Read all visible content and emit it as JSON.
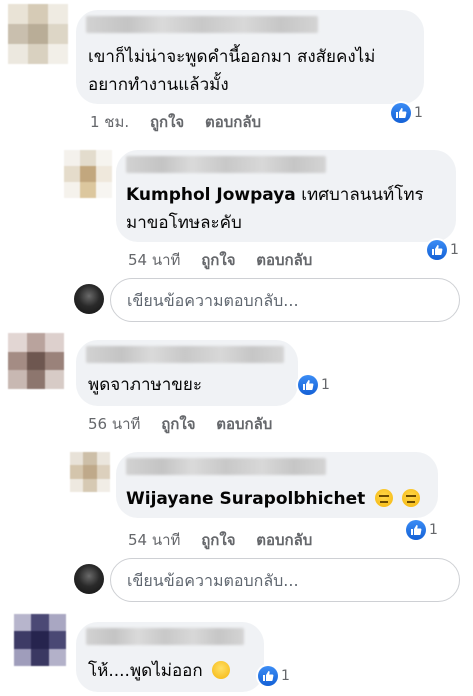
{
  "colors": {
    "bubble": "#f0f2f5",
    "like_blue": "#1877f2",
    "meta_gray": "#65676b",
    "text": "#050505"
  },
  "comments": [
    {
      "text_lines": [
        "เขาก็ไม่น่าจะพูดคำนี้ออกมา สงสัยคงไม่",
        "อยากทำงานแล้วมั้ง"
      ],
      "time": "1 ชม.",
      "like_label": "ถูกใจ",
      "reply_label": "ตอบกลับ",
      "reaction_count": "1",
      "reaction_icon": "like-icon"
    },
    {
      "mention": "Kumphol Jowpaya",
      "text_after_mention": "เทศบาลนนท์โทร",
      "text_line2": "มาขอโทษละคับ",
      "time": "54 นาที",
      "like_label": "ถูกใจ",
      "reply_label": "ตอบกลับ",
      "reaction_count": "1",
      "reaction_icon": "like-icon"
    },
    {
      "text": "พูดจาภาษาขยะ",
      "time": "56 นาที",
      "like_label": "ถูกใจ",
      "reply_label": "ตอบกลับ",
      "reaction_count": "1",
      "reaction_icon": "like-icon"
    },
    {
      "mention": "Wijayane Surapolbhichet",
      "emojis": [
        "expressionless-face-icon",
        "expressionless-face-icon"
      ],
      "time": "54 นาที",
      "like_label": "ถูกใจ",
      "reply_label": "ตอบกลับ",
      "reaction_count": "1",
      "reaction_icon": "like-icon"
    },
    {
      "text": "โห้....พูดไม่ออก",
      "emoji": "grinning-sweat-face-icon",
      "reaction_count": "1",
      "reaction_icon": "like-icon"
    }
  ],
  "reply_inputs": [
    {
      "placeholder": "เขียนข้อความตอบกลับ..."
    },
    {
      "placeholder": "เขียนข้อความตอบกลับ..."
    }
  ]
}
